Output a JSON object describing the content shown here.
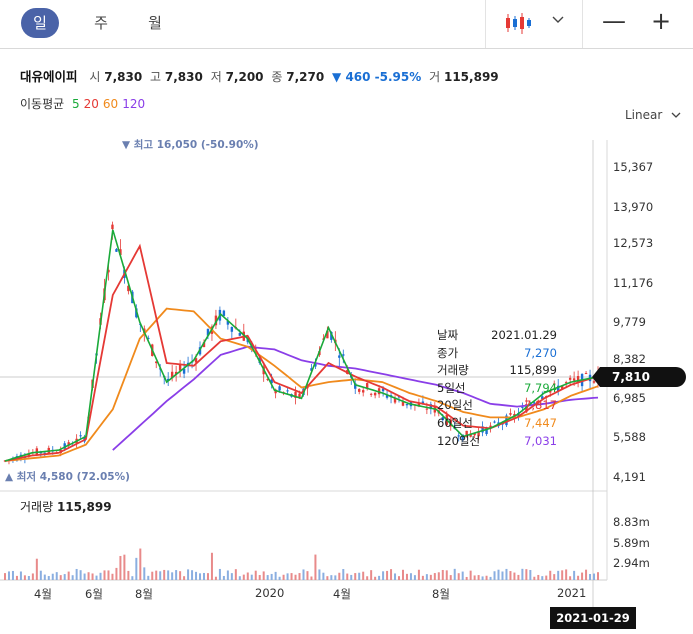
{
  "periods": [
    {
      "label": "일",
      "active": true
    },
    {
      "label": "주",
      "active": false
    },
    {
      "label": "월",
      "active": false
    }
  ],
  "chart_type_icon": "candlestick-icon",
  "zoom_out": "—",
  "zoom_in": "+",
  "stock": {
    "name": "대유에이피",
    "open_label": "시",
    "open": "7,830",
    "high_label": "고",
    "high": "7,830",
    "low_label": "저",
    "low": "7,200",
    "close_label": "종",
    "close": "7,270",
    "change": "▼ 460 -5.95%",
    "volume_label": "거",
    "volume": "115,899"
  },
  "moving_average": {
    "label": "이동평균",
    "periods": [
      {
        "value": "5",
        "color": "#1aaa3a"
      },
      {
        "value": "20",
        "color": "#e53935"
      },
      {
        "value": "60",
        "color": "#f08a1c"
      },
      {
        "value": "120",
        "color": "#8a3ee8"
      }
    ]
  },
  "scale_mode": "Linear",
  "y_ticks": [
    "15,367",
    "13,970",
    "12,573",
    "11,176",
    "9,779",
    "8,382",
    "6,985",
    "5,588",
    "4,191"
  ],
  "high_marker": "▼ 최고 16,050 (-50.90%)",
  "low_marker": "▲ 최저 4,580 (72.05%)",
  "current_price": "7,810",
  "tooltip": {
    "rows": [
      {
        "label": "날짜",
        "value": "2021.01.29",
        "color": "#222222"
      },
      {
        "label": "종가",
        "value": "7,270",
        "color": "#1a6fd4"
      },
      {
        "label": "거래량",
        "value": "115,899",
        "color": "#222222"
      },
      {
        "label": "5일선",
        "value": "7,794",
        "color": "#1aaa3a"
      },
      {
        "label": "20일선",
        "value": "7,817",
        "color": "#e53935"
      },
      {
        "label": "60일선",
        "value": "7,447",
        "color": "#f08a1c"
      },
      {
        "label": "120일선",
        "value": "7,031",
        "color": "#8a3ee8"
      }
    ]
  },
  "volume": {
    "label": "거래량",
    "value": "115,899",
    "ticks": [
      "8.83m",
      "5.89m",
      "2.94m"
    ]
  },
  "x_ticks": [
    "4월",
    "6월",
    "8월",
    "2020",
    "4월",
    "8월",
    "2021"
  ],
  "cursor_date": "2021-01-29",
  "chart_data": {
    "type": "line",
    "x": [
      "2019-03",
      "2019-04",
      "2019-05",
      "2019-06",
      "2019-07",
      "2019-08",
      "2019-09",
      "2019-10",
      "2019-11",
      "2019-12",
      "2020-01",
      "2020-02",
      "2020-03",
      "2020-04",
      "2020-05",
      "2020-06",
      "2020-07",
      "2020-08",
      "2020-09",
      "2020-10",
      "2020-11",
      "2020-12",
      "2021-01"
    ],
    "series": [
      {
        "name": "5",
        "color": "#1aaa3a",
        "values": [
          4700,
          5000,
          5100,
          5600,
          13200,
          9800,
          7600,
          8400,
          10100,
          9200,
          7300,
          7000,
          9600,
          7500,
          7200,
          6800,
          6600,
          5600,
          5900,
          6400,
          7200,
          7600,
          7794
        ]
      },
      {
        "name": "20",
        "color": "#e53935",
        "values": [
          4700,
          4900,
          5000,
          5500,
          10800,
          12600,
          8300,
          8200,
          9100,
          9300,
          7600,
          7200,
          8300,
          7800,
          7400,
          6900,
          6700,
          6000,
          5900,
          6300,
          7000,
          7500,
          7817
        ]
      },
      {
        "name": "60",
        "color": "#f08a1c",
        "values": [
          4700,
          4800,
          4900,
          5300,
          6600,
          9200,
          10300,
          10200,
          9200,
          8900,
          8200,
          7400,
          7600,
          7700,
          7600,
          7200,
          6900,
          6500,
          6300,
          6300,
          6600,
          7100,
          7447
        ]
      },
      {
        "name": "120",
        "color": "#8a3ee8",
        "values": [
          null,
          null,
          null,
          null,
          5100,
          6000,
          6900,
          7700,
          8600,
          8900,
          8800,
          8400,
          8200,
          8100,
          7900,
          7700,
          7500,
          7200,
          6800,
          6700,
          6800,
          6950,
          7031
        ]
      }
    ],
    "y_ticks": [
      15367,
      13970,
      12573,
      11176,
      9779,
      8382,
      6985,
      5588,
      4191
    ],
    "ylim": [
      4000,
      16500
    ],
    "volume_ticks": [
      "8.83m",
      "5.89m",
      "2.94m"
    ]
  }
}
